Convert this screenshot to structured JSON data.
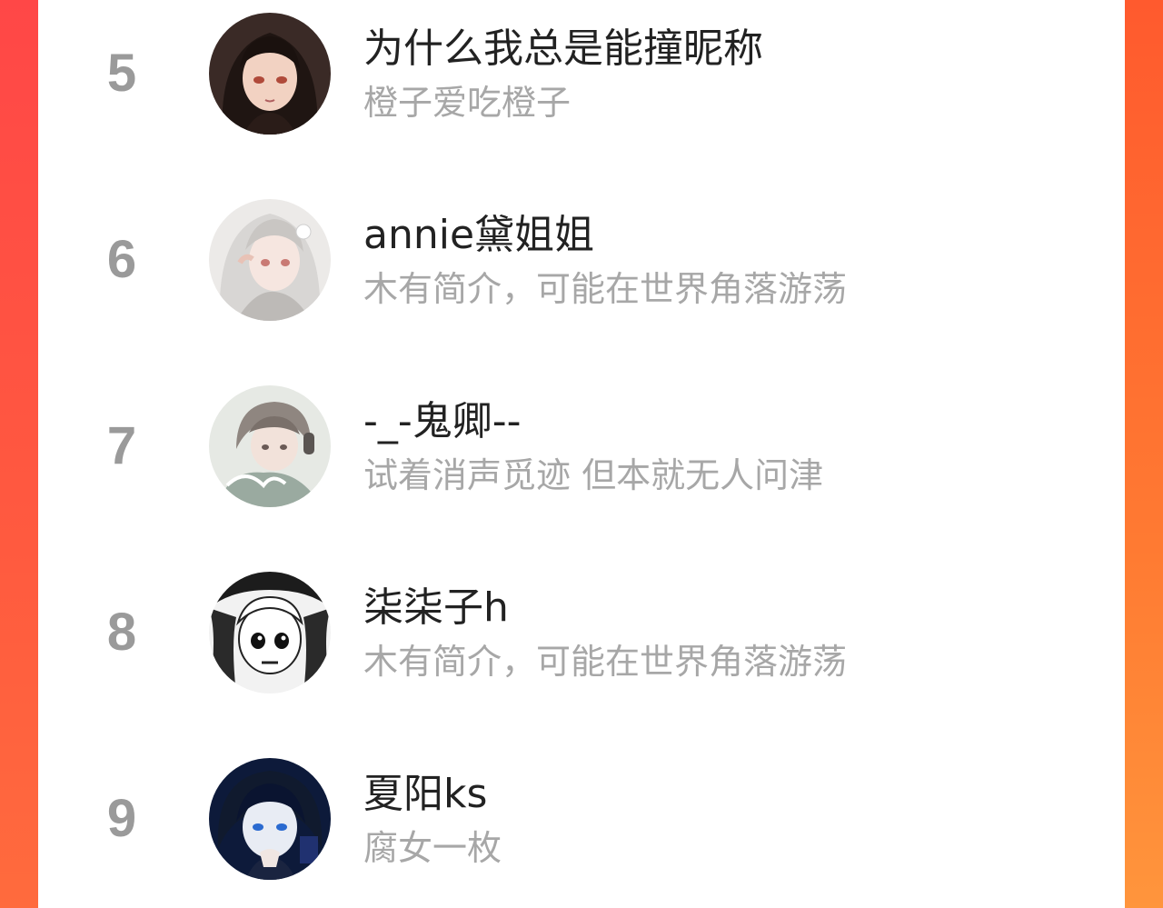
{
  "colors": {
    "rank": "#9a9a9a",
    "name": "#222222",
    "bio": "#a7a7a7",
    "border_left": "#ff4a45",
    "border_right": "#ff8f3a"
  },
  "list": {
    "items": [
      {
        "rank": "5",
        "name": "为什么我总是能撞昵称",
        "bio": "橙子爱吃橙子",
        "avatar_icon": "anime-girl-dark-hair-avatar"
      },
      {
        "rank": "6",
        "name": "annie黛姐姐",
        "bio": "木有简介，可能在世界角落游荡",
        "avatar_icon": "anime-girl-white-hair-avatar"
      },
      {
        "rank": "7",
        "name": "-_-鬼卿--",
        "bio": "试着消声觅迹 但本就无人问津",
        "avatar_icon": "anime-boy-headphones-avatar"
      },
      {
        "rank": "8",
        "name": "柒柒子h",
        "bio": "木有简介，可能在世界角落游荡",
        "avatar_icon": "manga-girl-monochrome-avatar"
      },
      {
        "rank": "9",
        "name": "夏阳ks",
        "bio": "腐女一枚",
        "avatar_icon": "anime-boy-blue-avatar"
      }
    ]
  }
}
